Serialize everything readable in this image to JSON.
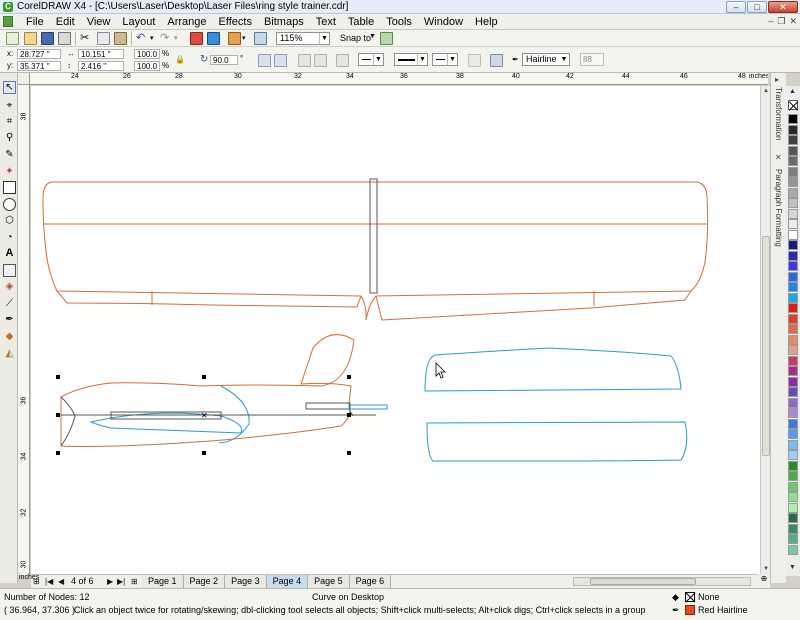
{
  "window": {
    "title": "CorelDRAW X4 - [C:\\Users\\Laser\\Desktop\\Laser Files\\ring style trainer.cdr]",
    "app_icon_glyph": "C"
  },
  "menu": [
    "File",
    "Edit",
    "View",
    "Layout",
    "Arrange",
    "Effects",
    "Bitmaps",
    "Text",
    "Table",
    "Tools",
    "Window",
    "Help"
  ],
  "toolbar": {
    "zoom": "115%",
    "snap_to": "Snap to"
  },
  "property_bar": {
    "x": "28.727 \"",
    "y": "35.371 \"",
    "width": "10.151 \"",
    "height": "2.416 \"",
    "scale_x": "100.0",
    "scale_y": "100.0",
    "percent_sign": "%",
    "rotation": "90.0",
    "degree_sign": "°",
    "x_label": "x:",
    "y_label": "y:",
    "outline_width": "Hairline",
    "miter": "88"
  },
  "rulers": {
    "horizontal_labels": [
      "24",
      "26",
      "28",
      "30",
      "32",
      "34",
      "36",
      "38",
      "40",
      "42",
      "44",
      "46",
      "48"
    ],
    "unit": "inches",
    "vertical_labels": [
      "38",
      "36",
      "34",
      "32",
      "30"
    ]
  },
  "dockers": [
    "Transformation",
    "Paragraph Formatting"
  ],
  "page_nav": {
    "counter": "4 of 6",
    "tabs": [
      "Page 1",
      "Page 2",
      "Page 3",
      "Page 4",
      "Page 5",
      "Page 6"
    ],
    "active_tab": "Page 4",
    "unit_label": "inches"
  },
  "status": {
    "nodes": "Number of Nodes: 12",
    "object": "Curve on Desktop",
    "coords": "( 36.964, 37.306 )",
    "hint": "Click an object twice for rotating/skewing; dbl-clicking tool selects all objects; Shift+click multi-selects; Alt+click digs; Ctrl+click selects in a group",
    "fill_label": "None",
    "outline_label": "Red  Hairline"
  },
  "colors": {
    "wing_outline": "#c8703c",
    "tail_outline": "#2a9ac8",
    "selection_handle": "#000000",
    "active_page": "#c8dcf0",
    "outline_color": "#e84a1a"
  },
  "palette": [
    "#000000",
    "#2a2a2a",
    "#404040",
    "#555555",
    "#6a6a6a",
    "#808080",
    "#959595",
    "#aaaaaa",
    "#c0c0c0",
    "#d6d6d6",
    "#ececec",
    "#ffffff",
    "#1a1a7a",
    "#2a2ab0",
    "#3a3ae0",
    "#2a6ae0",
    "#1a8ae0",
    "#1aaae0",
    "#e01a1a",
    "#e0402a",
    "#e06a4a",
    "#e08a6a",
    "#e0a08a",
    "#c83a6a",
    "#a82a8a",
    "#8a2aa8",
    "#6a4ab0",
    "#8a6ac8",
    "#aa8ad8",
    "#3a7ad8",
    "#5a9ae8",
    "#7ab8f0",
    "#9ad0f8",
    "#2a8a2a",
    "#4aaa4a",
    "#6aca6a",
    "#8ae08a",
    "#aaf0aa",
    "#2a6a4a",
    "#3a8a6a",
    "#5aaa8a",
    "#7ac8aa"
  ]
}
